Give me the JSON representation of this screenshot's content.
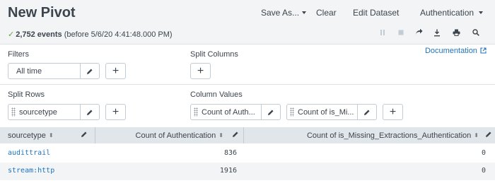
{
  "header": {
    "title": "New Pivot",
    "save_as": "Save As...",
    "clear": "Clear",
    "edit_dataset": "Edit Dataset",
    "dataset_menu": "Authentication"
  },
  "status": {
    "events": "2,752 events",
    "before": "(before 5/6/20 4:41:48.000 PM)"
  },
  "toolbar_icons": [
    "pause-icon",
    "stop-icon",
    "share-icon",
    "export-icon",
    "print-icon",
    "inspect-icon"
  ],
  "documentation": "Documentation",
  "filters": {
    "label": "Filters",
    "items": [
      "All time"
    ]
  },
  "split_columns": {
    "label": "Split Columns"
  },
  "split_rows": {
    "label": "Split Rows",
    "items": [
      "sourcetype"
    ]
  },
  "column_values": {
    "label": "Column Values",
    "items": [
      "Count of Auth...",
      "Count of is_Mi..."
    ]
  },
  "table": {
    "columns": [
      "sourcetype",
      "Count of Authentication",
      "Count of is_Missing_Extractions_Authentication"
    ],
    "rows": [
      [
        "audittrail",
        "836",
        "0"
      ],
      [
        "stream:http",
        "1916",
        "0"
      ]
    ]
  },
  "colors": {
    "link": "#1e73be",
    "success": "#65a637",
    "header_bg": "#f2f4f5",
    "table_header_bg": "#e1e6eb",
    "row_alt": "#f2f4f5"
  }
}
